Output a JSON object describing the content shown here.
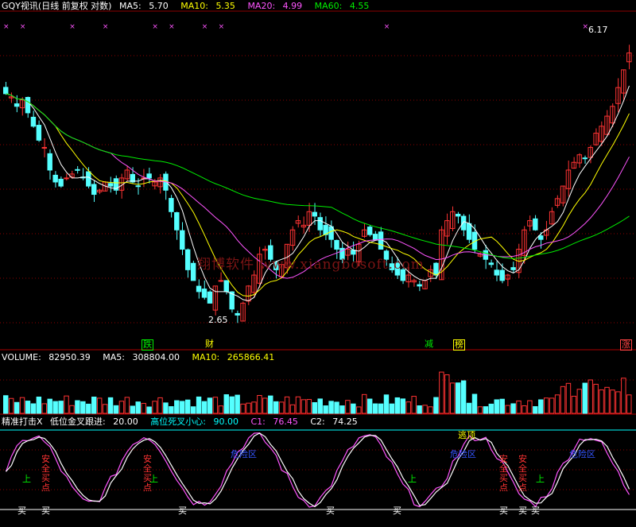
{
  "main_header": {
    "title": "GQY视讯(日线 前复权 对数)",
    "items": [
      {
        "label": "MA5:",
        "value": "5.70",
        "color": "#ffffff"
      },
      {
        "label": "MA10:",
        "value": "5.35",
        "color": "#ffff00"
      },
      {
        "label": "MA20:",
        "value": "4.99",
        "color": "#ff55ff"
      },
      {
        "label": "MA60:",
        "value": "4.55",
        "color": "#00ee00"
      }
    ]
  },
  "volume_header": {
    "items": [
      {
        "label": "VOLUME:",
        "value": "82950.39",
        "color": "#ffffff"
      },
      {
        "label": "MA5:",
        "value": "308804.00",
        "color": "#ffffff"
      },
      {
        "label": "MA10:",
        "value": "265866.41",
        "color": "#ffff00"
      }
    ]
  },
  "indicator_header": {
    "items": [
      {
        "label": "精准打击X",
        "value": "",
        "color": "#ffffff"
      },
      {
        "label": "低位金叉跟进:",
        "value": "20.00",
        "color": "#ffffff"
      },
      {
        "label": "高位死叉小心:",
        "value": "90.00",
        "color": "#00ffff"
      },
      {
        "label": "C1:",
        "value": "76.45",
        "color": "#ff55ff"
      },
      {
        "label": "C2:",
        "value": "74.25",
        "color": "#ffffff"
      }
    ]
  },
  "price_annotations": {
    "high": "6.17",
    "low": "2.65"
  },
  "signal_markers": [
    {
      "text": "跌",
      "color": "#00ee00"
    },
    {
      "text": "财",
      "color": "#ffff00"
    },
    {
      "text": "减",
      "color": "#00ee00"
    },
    {
      "text": "榜",
      "color": "#ffff00"
    },
    {
      "text": "涨",
      "color": "#ff4444"
    }
  ],
  "indicator_labels": {
    "safe_buy": "安全买点",
    "buy": "买",
    "escape": "逃顶",
    "danger": "危险区",
    "up": "上"
  },
  "watermark": "翔博软件 www.xiangbosoft.com",
  "colors": {
    "up": "#ff3333",
    "down": "#55ffff",
    "ma5": "#ffffff",
    "ma10": "#ffff00",
    "ma20": "#ff55ff",
    "ma60": "#00ee00",
    "grid": "#8b0000",
    "cross": "#ff55ff"
  },
  "chart_data": [
    {
      "type": "candlestick",
      "title": "GQY视讯(日线 前复权 对数)",
      "series": [
        {
          "name": "MA5",
          "last": 5.7
        },
        {
          "name": "MA10",
          "last": 5.35
        },
        {
          "name": "MA20",
          "last": 4.99
        },
        {
          "name": "MA60",
          "last": 4.55
        }
      ],
      "close": [
        5.3,
        5.25,
        5.1,
        5.2,
        5.0,
        4.8,
        4.6,
        4.5,
        4.2,
        4.05,
        4.0,
        4.1,
        4.15,
        4.2,
        4.1,
        4.0,
        3.9,
        3.95,
        4.05,
        4.0,
        3.95,
        4.1,
        4.2,
        4.05,
        4.0,
        4.1,
        4.1,
        4.05,
        4.1,
        3.95,
        3.7,
        3.5,
        3.3,
        3.1,
        3.0,
        2.9,
        2.85,
        2.8,
        2.95,
        3.0,
        2.9,
        2.75,
        2.7,
        2.8,
        2.95,
        3.05,
        3.25,
        3.3,
        3.2,
        3.1,
        3.15,
        3.35,
        3.5,
        3.6,
        3.55,
        3.7,
        3.65,
        3.5,
        3.45,
        3.4,
        3.3,
        3.2,
        3.3,
        3.25,
        3.35,
        3.5,
        3.45,
        3.4,
        3.3,
        3.2,
        3.1,
        3.05,
        3.0,
        3.05,
        3.0,
        2.95,
        3.0,
        3.1,
        3.05,
        3.5,
        3.6,
        3.7,
        3.65,
        3.5,
        3.4,
        3.3,
        3.25,
        3.2,
        3.15,
        3.05,
        3.0,
        3.05,
        3.1,
        3.3,
        3.5,
        3.6,
        3.5,
        3.4,
        3.5,
        3.7,
        3.85,
        4.0,
        4.2,
        4.3,
        4.4,
        4.35,
        4.5,
        4.7,
        4.8,
        4.95,
        5.1,
        5.4,
        5.7,
        6.0
      ]
    },
    {
      "type": "bar",
      "title": "VOLUME",
      "series": [
        {
          "name": "VOLUME",
          "last": 82950.39
        },
        {
          "name": "MA5",
          "last": 308804.0
        },
        {
          "name": "MA10",
          "last": 265866.41
        }
      ]
    },
    {
      "type": "line",
      "title": "精准打击X",
      "ylim": [
        0,
        100
      ],
      "reference_lines": [
        20,
        90
      ],
      "series": [
        {
          "name": "C1",
          "last": 76.45
        },
        {
          "name": "C2",
          "last": 74.25
        }
      ]
    }
  ]
}
